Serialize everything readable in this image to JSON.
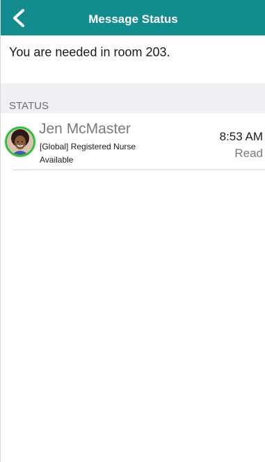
{
  "nav": {
    "title": "Message Status",
    "back_icon": "chevron-left-icon",
    "background_color": "#138c8f"
  },
  "message": {
    "body": "You are needed in room 203."
  },
  "status_section": {
    "header": "STATUS",
    "recipients": [
      {
        "name": "Jen McMaster",
        "role": "[Global] Registered Nurse",
        "availability": "Available",
        "time": "8:53 AM",
        "status": "Read",
        "presence_color": "#2fbf3a"
      }
    ]
  }
}
